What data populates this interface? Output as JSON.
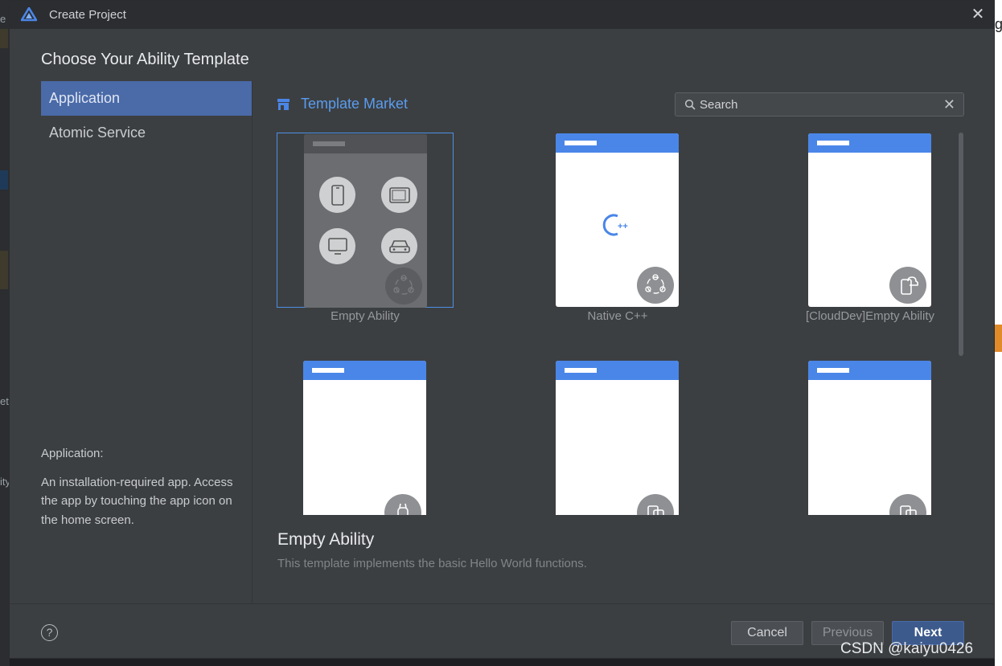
{
  "window": {
    "title": "Create Project",
    "close_glyph": "✕"
  },
  "heading": "Choose Your Ability Template",
  "sidebar": {
    "items": [
      {
        "label": "Application",
        "active": true
      },
      {
        "label": "Atomic Service",
        "active": false
      }
    ],
    "description_title": "Application:",
    "description": "An installation-required app. Access the app by touching the app icon on the home screen."
  },
  "market": {
    "label": "Template Market",
    "icon": "store-icon"
  },
  "search": {
    "placeholder": "Search",
    "value": "",
    "clear_glyph": "✕"
  },
  "templates": [
    {
      "label": "Empty Ability",
      "selected": true,
      "icon": "multi-device-icon"
    },
    {
      "label": "Native C++",
      "selected": false,
      "icon": "cpp-icon"
    },
    {
      "label": "[CloudDev]Empty Ability",
      "selected": false,
      "icon": "cloud-device-icon"
    },
    {
      "label": "",
      "selected": false,
      "icon": "watch-icon"
    },
    {
      "label": "",
      "selected": false,
      "icon": "device-switch-icon"
    },
    {
      "label": "",
      "selected": false,
      "icon": "device-switch-icon"
    }
  ],
  "detail": {
    "title": "Empty Ability",
    "description": "This template implements the basic Hello World functions."
  },
  "footer": {
    "help_glyph": "?",
    "cancel": "Cancel",
    "previous": "Previous",
    "next": "Next"
  },
  "watermark": "CSDN @kaiyu0426",
  "background_fragments": {
    "left_1": "e",
    "left_2": "et",
    "left_3": "ity",
    "right_1": "g"
  },
  "colors": {
    "accent": "#4a86e8",
    "selected_side": "#4a6aa8",
    "link": "#5a9cf0",
    "dialog_bg": "#3c3f41"
  }
}
